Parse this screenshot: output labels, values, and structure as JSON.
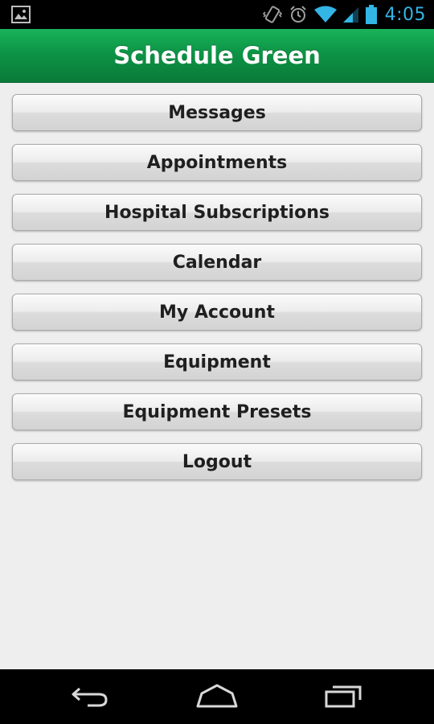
{
  "status_bar": {
    "time": "4:05",
    "icons": [
      "image-notification-icon",
      "vibrate-icon",
      "alarm-icon",
      "wifi-icon",
      "signal-icon",
      "battery-icon"
    ]
  },
  "header": {
    "title": "Schedule Green"
  },
  "menu": {
    "items": [
      {
        "label": "Messages"
      },
      {
        "label": "Appointments"
      },
      {
        "label": "Hospital Subscriptions"
      },
      {
        "label": "Calendar"
      },
      {
        "label": "My Account"
      },
      {
        "label": "Equipment"
      },
      {
        "label": "Equipment Presets"
      },
      {
        "label": "Logout"
      }
    ]
  },
  "nav_bar": {
    "icons": [
      "back-icon",
      "home-icon",
      "recent-apps-icon"
    ]
  },
  "colors": {
    "header_green": "#0d9446",
    "status_blue": "#33b5e5",
    "background": "#eeeeee"
  }
}
